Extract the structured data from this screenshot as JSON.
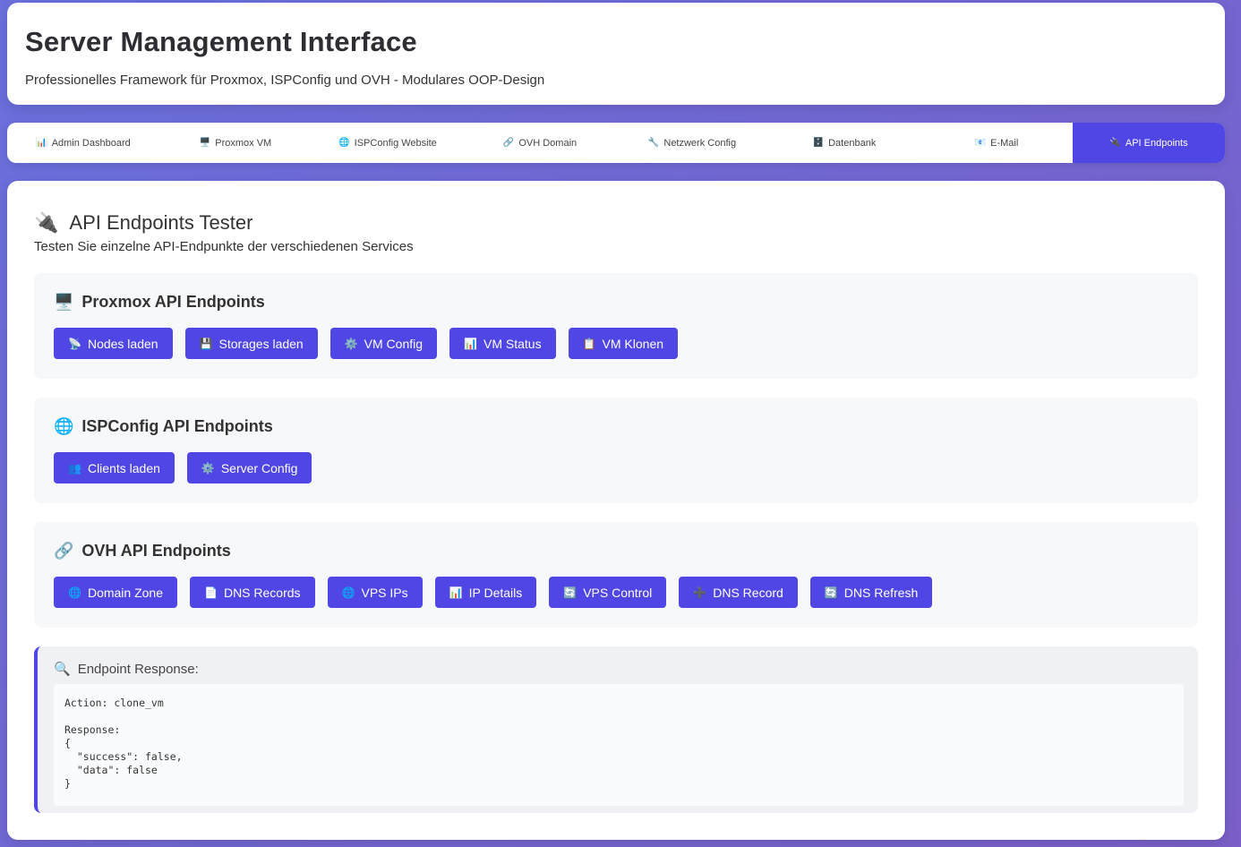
{
  "header": {
    "title": "Server Management Interface",
    "subtitle": "Professionelles Framework für Proxmox, ISPConfig und OVH - Modulares OOP-Design"
  },
  "tabs": [
    {
      "icon": "📊",
      "icon_name": "chart-icon",
      "label": "Admin Dashboard",
      "active": false
    },
    {
      "icon": "🖥️",
      "icon_name": "monitor-icon",
      "label": "Proxmox VM",
      "active": false
    },
    {
      "icon": "🌐",
      "icon_name": "globe-icon",
      "label": "ISPConfig Website",
      "active": false
    },
    {
      "icon": "🔗",
      "icon_name": "link-icon",
      "label": "OVH Domain",
      "active": false
    },
    {
      "icon": "🔧",
      "icon_name": "wrench-icon",
      "label": "Netzwerk Config",
      "active": false
    },
    {
      "icon": "🗄️",
      "icon_name": "database-icon",
      "label": "Datenbank",
      "active": false
    },
    {
      "icon": "📧",
      "icon_name": "mail-icon",
      "label": "E-Mail",
      "active": false
    },
    {
      "icon": "🔌",
      "icon_name": "plug-icon",
      "label": "API Endpoints",
      "active": true
    }
  ],
  "page": {
    "title_icon": "🔌",
    "title": "API Endpoints Tester",
    "subtitle": "Testen Sie einzelne API-Endpunkte der verschiedenen Services"
  },
  "sections": [
    {
      "icon": "🖥️",
      "icon_name": "monitor-icon",
      "title": "Proxmox API Endpoints",
      "buttons": [
        {
          "icon": "📡",
          "icon_name": "satellite-icon",
          "label": "Nodes laden"
        },
        {
          "icon": "💾",
          "icon_name": "disk-icon",
          "label": "Storages laden"
        },
        {
          "icon": "⚙️",
          "icon_name": "gear-icon",
          "label": "VM Config"
        },
        {
          "icon": "📊",
          "icon_name": "chart-icon",
          "label": "VM Status"
        },
        {
          "icon": "📋",
          "icon_name": "clipboard-icon",
          "label": "VM Klonen"
        }
      ]
    },
    {
      "icon": "🌐",
      "icon_name": "globe-icon",
      "title": "ISPConfig API Endpoints",
      "buttons": [
        {
          "icon": "👥",
          "icon_name": "users-icon",
          "label": "Clients laden"
        },
        {
          "icon": "⚙️",
          "icon_name": "gear-icon",
          "label": "Server Config"
        }
      ]
    },
    {
      "icon": "🔗",
      "icon_name": "link-icon",
      "title": "OVH API Endpoints",
      "buttons": [
        {
          "icon": "🌐",
          "icon_name": "globe-icon",
          "label": "Domain Zone"
        },
        {
          "icon": "📄",
          "icon_name": "document-icon",
          "label": "DNS Records"
        },
        {
          "icon": "🌐",
          "icon_name": "globe-icon",
          "label": "VPS IPs"
        },
        {
          "icon": "📊",
          "icon_name": "chart-icon",
          "label": "IP Details"
        },
        {
          "icon": "🔄",
          "icon_name": "refresh-icon",
          "label": "VPS Control"
        },
        {
          "icon": "➕",
          "icon_name": "plus-icon",
          "label": "DNS Record"
        },
        {
          "icon": "🔄",
          "icon_name": "refresh-icon",
          "label": "DNS Refresh"
        }
      ]
    }
  ],
  "response": {
    "icon": "🔍",
    "title": "Endpoint Response:",
    "body": "Action: clone_vm\n\nResponse:\n{\n  \"success\": false,\n  \"data\": false\n}"
  }
}
